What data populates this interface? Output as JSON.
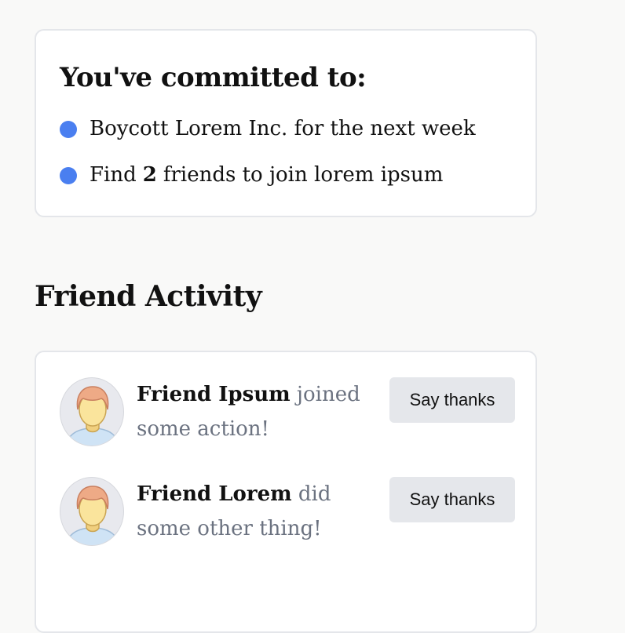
{
  "commitments": {
    "title": "You've committed to:",
    "items": [
      {
        "text": "Boycott Lorem Inc. for the next week"
      },
      {
        "prefix": "Find",
        "count": "2",
        "suffix": "friends to join lorem ipsum"
      }
    ],
    "bullet_color": "#4a7ff0"
  },
  "friend_activity": {
    "title": "Friend Activity",
    "items": [
      {
        "name": "Friend Ipsum",
        "action": "joined some action!",
        "button_label": "Say thanks",
        "avatar_icon": "person-avatar-icon"
      },
      {
        "name": "Friend Lorem",
        "action": "did some other thing!",
        "button_label": "Say thanks",
        "avatar_icon": "person-avatar-icon"
      }
    ]
  }
}
